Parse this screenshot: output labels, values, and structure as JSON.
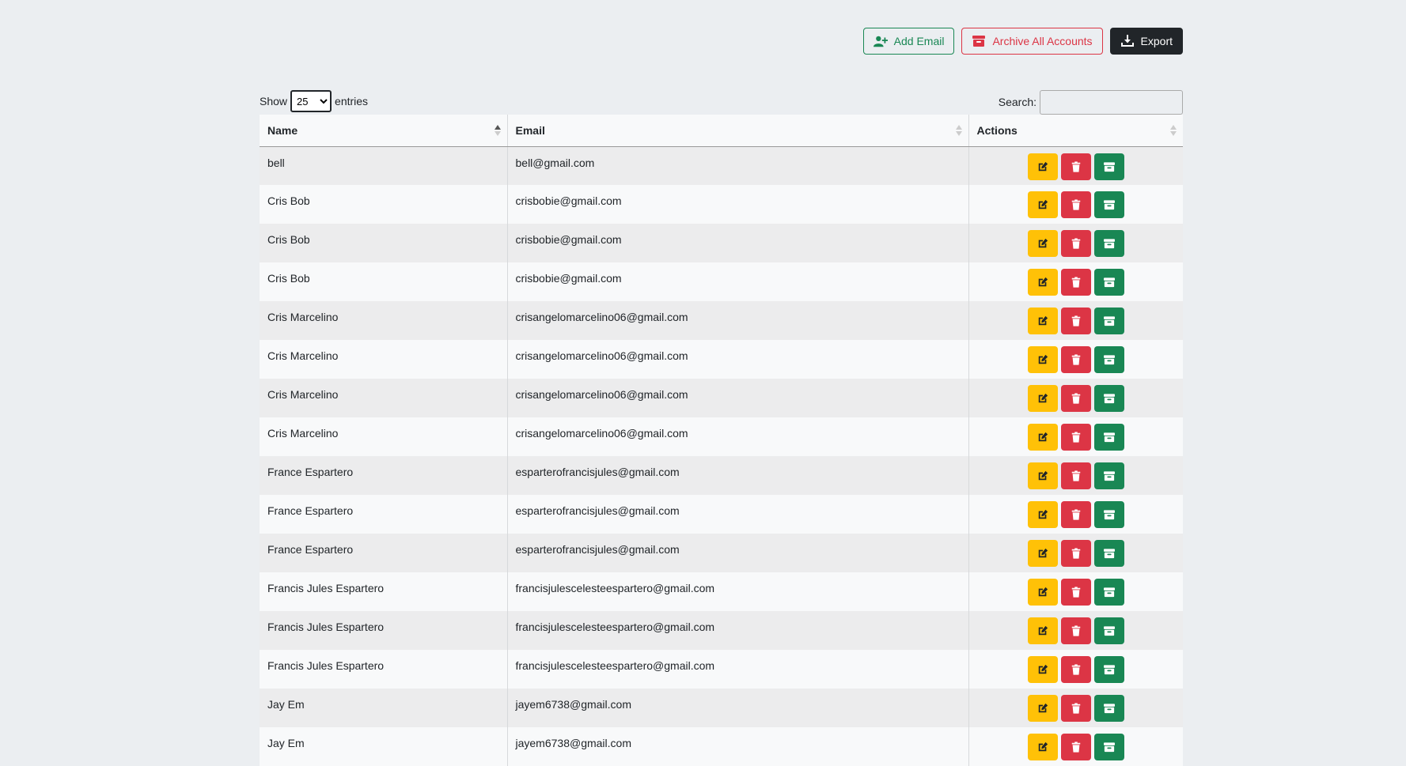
{
  "toolbar": {
    "add_email_label": "Add Email",
    "archive_all_label": "Archive All Accounts",
    "export_label": "Export"
  },
  "length_control": {
    "show_label": "Show",
    "selected": "25",
    "entries_label": "entries"
  },
  "search": {
    "label": "Search:",
    "value": ""
  },
  "table": {
    "columns": [
      "Name",
      "Email",
      "Actions"
    ],
    "rows": [
      {
        "name": "bell",
        "email": "bell@gmail.com"
      },
      {
        "name": "Cris Bob",
        "email": "crisbobie@gmail.com"
      },
      {
        "name": "Cris Bob",
        "email": "crisbobie@gmail.com"
      },
      {
        "name": "Cris Bob",
        "email": "crisbobie@gmail.com"
      },
      {
        "name": "Cris Marcelino",
        "email": "crisangelomarcelino06@gmail.com"
      },
      {
        "name": "Cris Marcelino",
        "email": "crisangelomarcelino06@gmail.com"
      },
      {
        "name": "Cris Marcelino",
        "email": "crisangelomarcelino06@gmail.com"
      },
      {
        "name": "Cris Marcelino",
        "email": "crisangelomarcelino06@gmail.com"
      },
      {
        "name": "France Espartero",
        "email": "esparterofrancisjules@gmail.com"
      },
      {
        "name": "France Espartero",
        "email": "esparterofrancisjules@gmail.com"
      },
      {
        "name": "France Espartero",
        "email": "esparterofrancisjules@gmail.com"
      },
      {
        "name": "Francis Jules Espartero",
        "email": "francisjulescelesteespartero@gmail.com"
      },
      {
        "name": "Francis Jules Espartero",
        "email": "francisjulescelesteespartero@gmail.com"
      },
      {
        "name": "Francis Jules Espartero",
        "email": "francisjulescelesteespartero@gmail.com"
      },
      {
        "name": "Jay Em",
        "email": "jayem6738@gmail.com"
      },
      {
        "name": "Jay Em",
        "email": "jayem6738@gmail.com"
      }
    ]
  },
  "colors": {
    "background": "#ebeef1",
    "success": "#198754",
    "danger": "#dc3545",
    "warning": "#ffc107",
    "dark": "#212529"
  }
}
